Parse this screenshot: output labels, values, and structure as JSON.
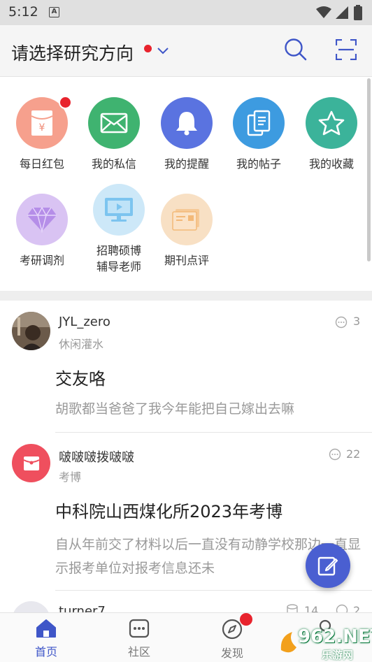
{
  "status_bar": {
    "time": "5:12",
    "sim_label": "A"
  },
  "header": {
    "title": "请选择研究方向"
  },
  "quick_actions": [
    {
      "label": "每日红包",
      "icon": "red-envelope-icon",
      "color": "#f6a08d",
      "badge": true
    },
    {
      "label": "我的私信",
      "icon": "envelope-icon",
      "color": "#3fb370",
      "badge": false
    },
    {
      "label": "我的提醒",
      "icon": "bell-icon",
      "color": "#5a73e0",
      "badge": false
    },
    {
      "label": "我的帖子",
      "icon": "documents-icon",
      "color": "#3d9be0",
      "badge": false
    },
    {
      "label": "我的收藏",
      "icon": "star-icon",
      "color": "#3bb39a",
      "badge": false
    },
    {
      "label": "考研调剂",
      "icon": "diamond-icon",
      "color": "#d9c3f3",
      "badge": false
    },
    {
      "label_line1": "招聘硕博",
      "label_line2": "辅导老师",
      "icon": "monitor-icon",
      "color": "#cde8f8",
      "badge": false
    },
    {
      "label": "期刊点评",
      "icon": "journal-icon",
      "color": "#f8e0c4",
      "badge": false
    }
  ],
  "posts": [
    {
      "user": "JYL_zero",
      "category": "休闲灌水",
      "comments": "3",
      "title": "交友咯",
      "excerpt": "胡歌都当爸爸了我今年能把自己嫁出去嘛"
    },
    {
      "user": "啵啵啵拨啵啵",
      "category": "考博",
      "comments": "22",
      "title": "中科院山西煤化所2023年考博",
      "excerpt": "自从年前交了材料以后一直没有动静学校那边一直显示报考单位对报考信息还未"
    },
    {
      "user": "turner7",
      "views": "14",
      "comments": "2"
    }
  ],
  "tab_bar": [
    {
      "label": "首页",
      "icon": "home-icon",
      "active": true
    },
    {
      "label": "社区",
      "icon": "chat-bubble-icon",
      "active": false
    },
    {
      "label": "发现",
      "icon": "compass-icon",
      "active": false,
      "badge": true
    },
    {
      "label": "",
      "icon": "person-icon",
      "active": false
    }
  ],
  "watermark": {
    "text": "962.NET",
    "sub": "乐游网"
  },
  "colors": {
    "accent": "#4a5fd1",
    "badge_red": "#e8232d"
  }
}
